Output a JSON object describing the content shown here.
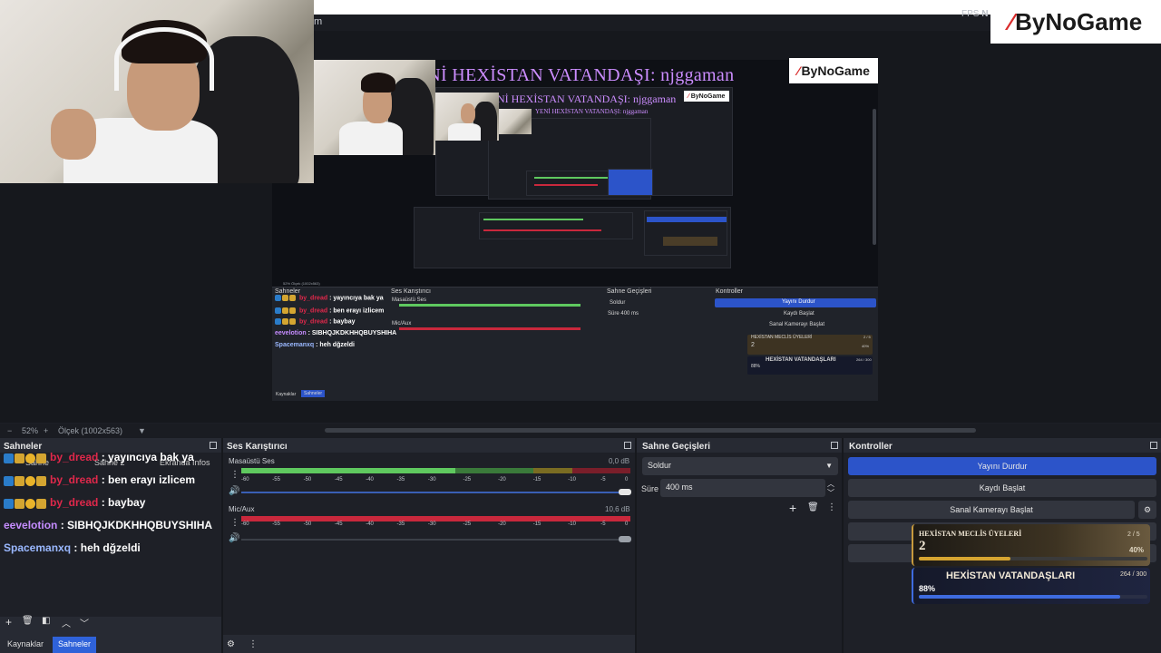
{
  "colors": {
    "accent": "#2c54c9",
    "panel": "#272a33",
    "username_red": "#e0284b",
    "username_purple": "#c58cff",
    "meter_green": "#5fc95f",
    "meter_yellow": "#c9b22b",
    "meter_red": "#c9283c",
    "bar_gold": "#d6a531",
    "bar_blue": "#3e6bdf"
  },
  "topbar": {
    "menu_fragment": "m",
    "fps": "FPS",
    "fps_fragment": "N"
  },
  "logo": {
    "brand": "ByNoGame",
    "mark": "⁄"
  },
  "preview": {
    "headline": "YENİ HEXİSTAN VATANDAŞI: njggaman",
    "headline_small": "YENİ HEXİSTAN VATANDAŞI: njggaman",
    "nested_labels": {
      "scenes": "Sahneler",
      "mixer": "Ses Karıştırıcı",
      "transitions": "Sahne Geçişleri",
      "controls": "Kontroller",
      "desktop_audio": "Masaüstü Ses",
      "mic": "Mic/Aux",
      "fade": "Soldur",
      "duration_label": "Süre",
      "duration_value": "400 ms",
      "stop_stream": "Yayını Durdur",
      "start_record": "Kaydı Başlat",
      "virtual_cam": "Sanal Kamerayı Başlat",
      "sources_tab": "Kaynaklar",
      "scenes_tab": "Sahneler",
      "zoom": "52%",
      "scale": "Ölçek (1002x563)",
      "card1_title": "HEXİSTAN MECLİS ÜYELERİ",
      "card1_value": "2",
      "card1_pct": "40%",
      "card1_count": "2 / 5",
      "card2_title": "HEXİSTAN VATANDAŞLARI",
      "card2_pct": "88%",
      "card2_count": "264 / 300"
    },
    "nested_chat": [
      {
        "user": "by_dread",
        "msg": "yayıncıya bak ya"
      },
      {
        "user": "by_dread",
        "msg": "ben erayı izlicem"
      },
      {
        "user": "by_dread",
        "msg": "baybay"
      },
      {
        "user": "eevelotion",
        "msg": "SIBHQJKDKHHQBUYSHIHA"
      },
      {
        "user": "Spacemanxq",
        "msg": "heh dğzeldi"
      }
    ]
  },
  "zoombar": {
    "minus": "−",
    "zoom": "52%",
    "plus": "+",
    "scale": "Ölçek (1002x563)"
  },
  "scenes_dock": {
    "title": "Sahneler",
    "hidden_labels": [
      "Sahne",
      "Sahne 2",
      "Ekranda Infos"
    ],
    "chat": [
      {
        "user": "by_dread",
        "sep": ":",
        "msg": "yayıncıya bak ya"
      },
      {
        "user": "by_dread",
        "sep": ":",
        "msg": "ben erayı izlicem"
      },
      {
        "user": "by_dread",
        "sep": ":",
        "msg": "baybay"
      },
      {
        "user": "eevelotion",
        "sep": ":",
        "msg": "SIBHQJKDKHHQBUYSHIHA"
      },
      {
        "user": "Spacemanxq",
        "sep": ":",
        "msg": "heh dğzeldi"
      }
    ],
    "tabs": {
      "sources": "Kaynaklar",
      "scenes": "Sahneler"
    }
  },
  "mixer": {
    "title": "Ses Karıştırıcı",
    "tracks": [
      {
        "name": "Masaüstü Ses",
        "db": "0,0 dB",
        "level": 0.82
      },
      {
        "name": "Mic/Aux",
        "db": "10,6 dB",
        "level": 0.7
      }
    ],
    "scale_labels": [
      "-60",
      "-55",
      "-50",
      "-45",
      "-40",
      "-35",
      "-30",
      "-25",
      "-20",
      "-15",
      "-10",
      "-5",
      "0"
    ]
  },
  "transitions": {
    "title": "Sahne Geçişleri",
    "type": "Soldur",
    "duration_label": "Süre",
    "duration_value": "400 ms"
  },
  "controls": {
    "title": "Kontroller",
    "stop_stream": "Yayını Durdur",
    "start_record": "Kaydı Başlat",
    "virtual_cam": "Sanal Kamerayı Başlat"
  },
  "overlay": {
    "card1": {
      "title": "HEXİSTAN MECLİS ÜYELERİ",
      "value": "2",
      "percent": "40%",
      "count": "2 / 5",
      "progress": 0.4
    },
    "card2": {
      "title": "HEXİSTAN VATANDAŞLARI",
      "percent": "88%",
      "count": "264 / 300",
      "progress": 0.88
    }
  }
}
